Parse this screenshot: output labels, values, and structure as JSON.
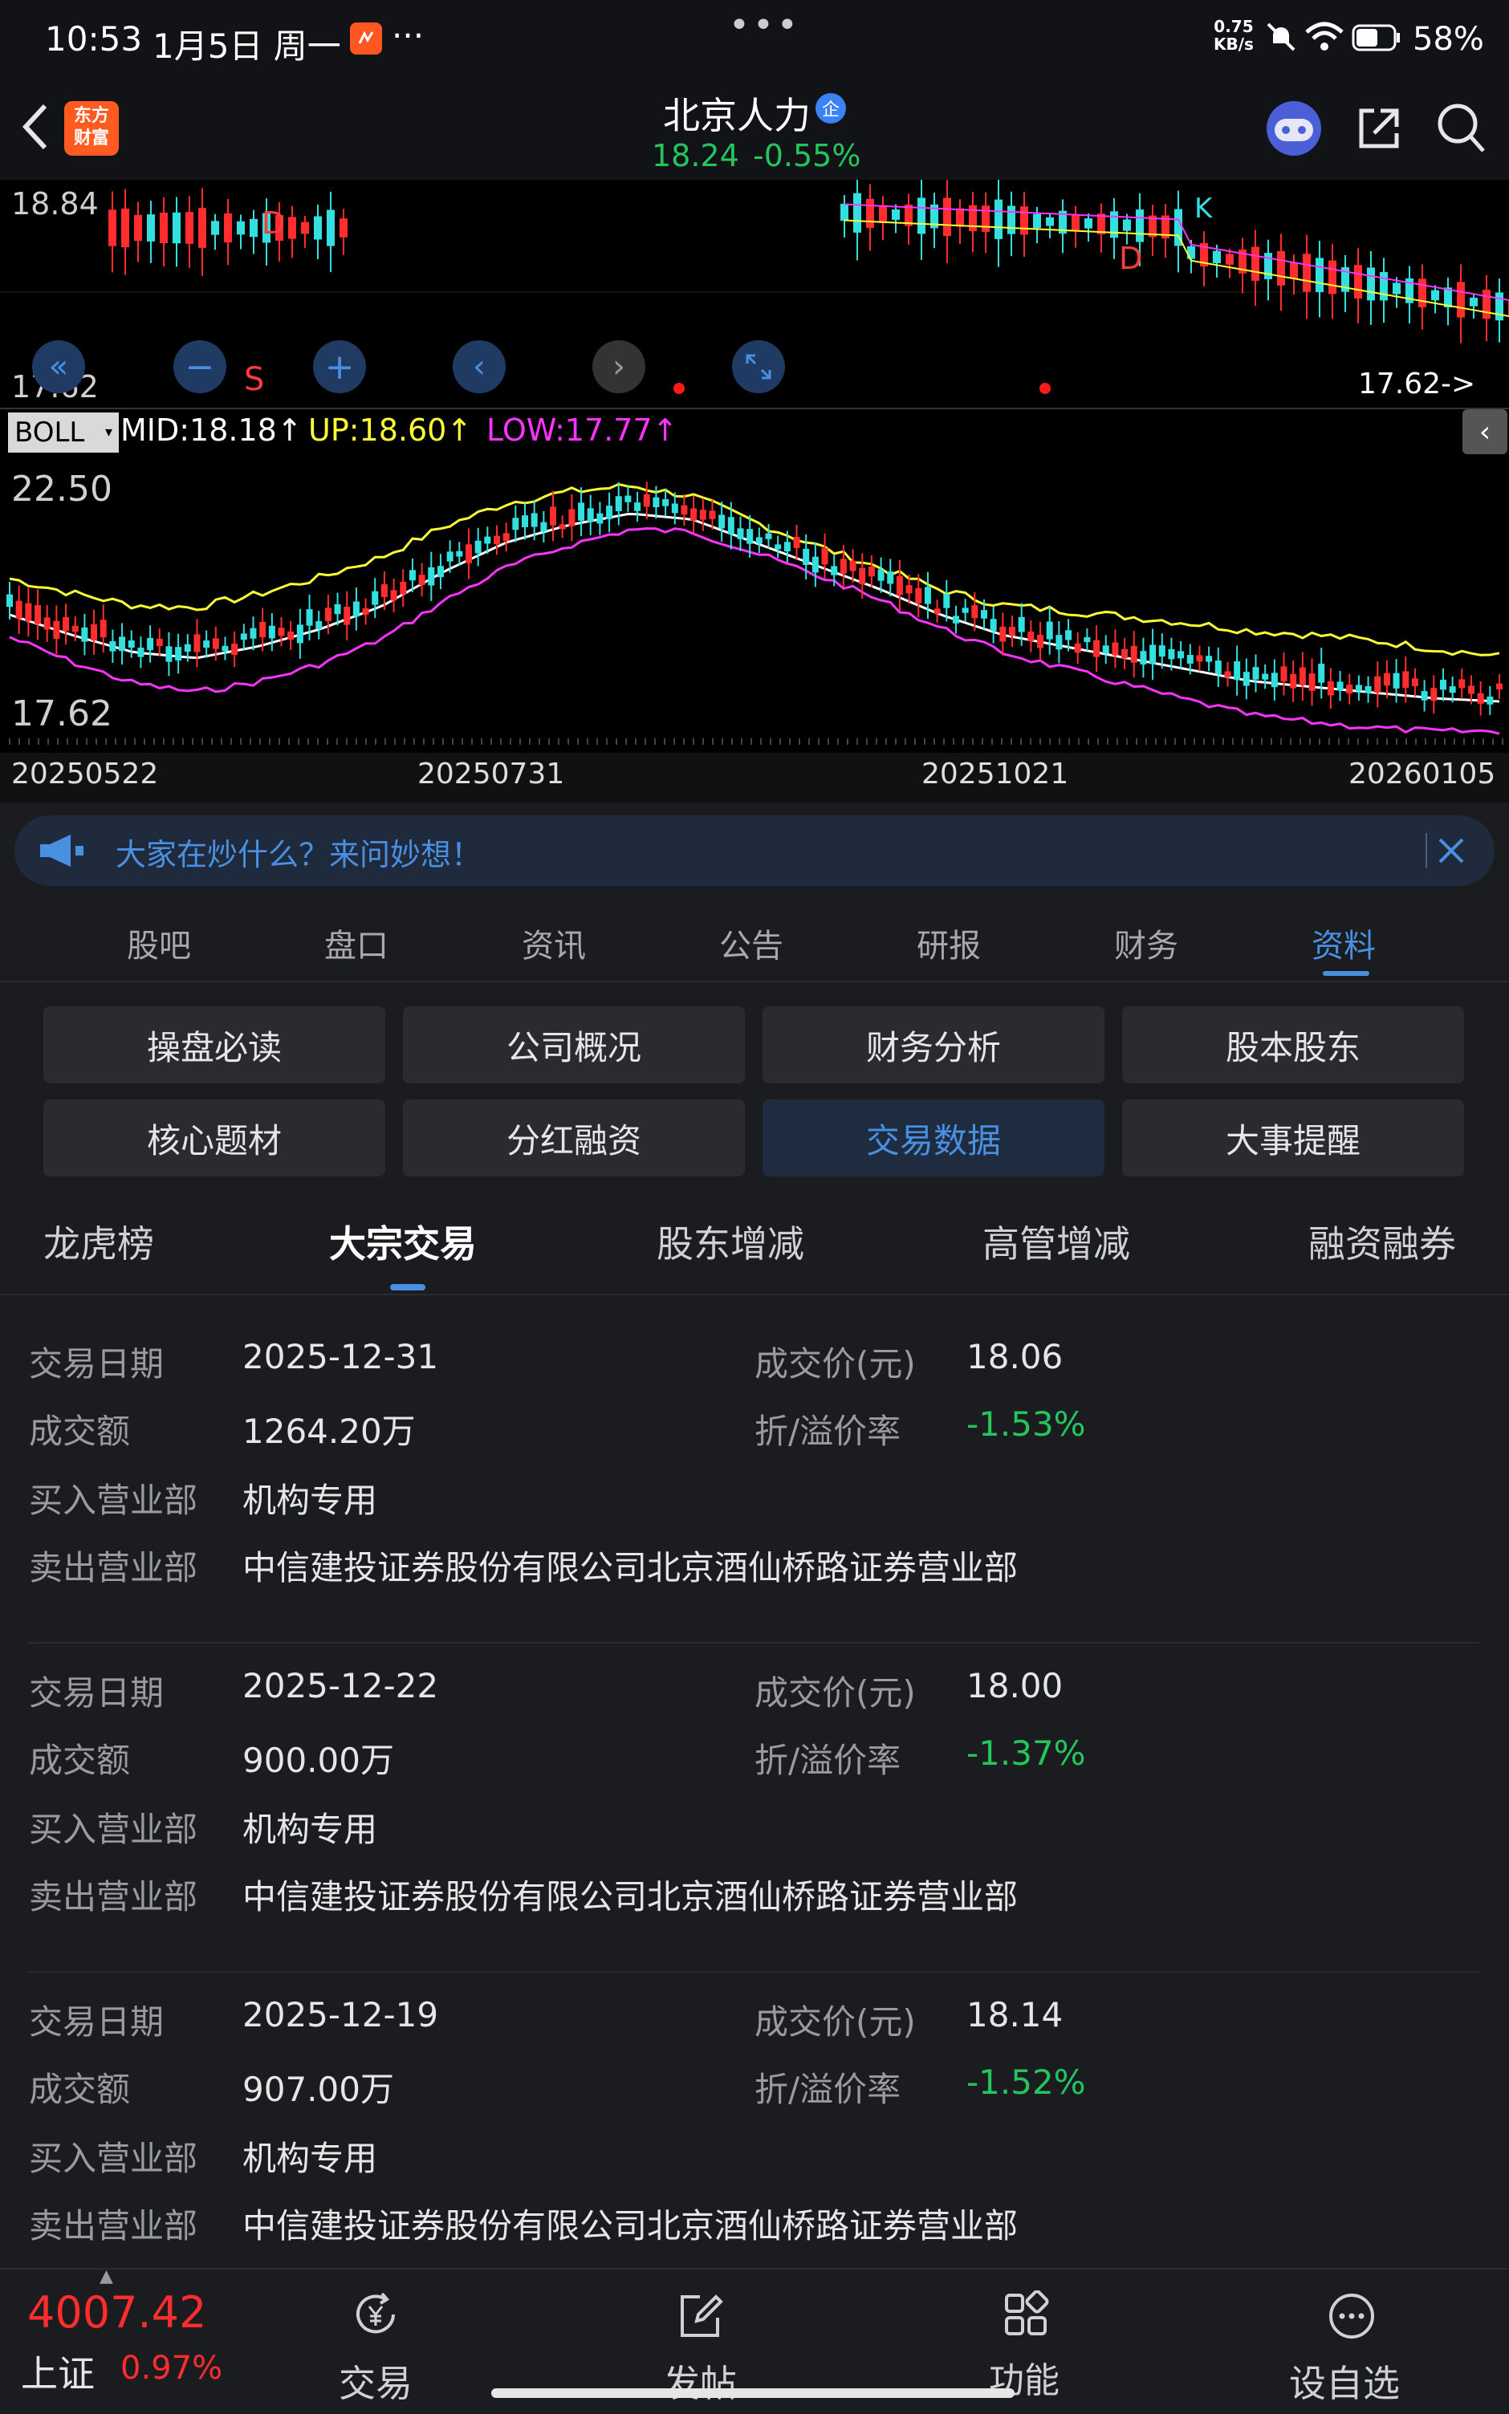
{
  "status": {
    "time": "10:53",
    "date": "1月5日 周一",
    "more": "···",
    "net_speed_value": "0.75",
    "net_speed_unit": "KB/s",
    "battery": "58%"
  },
  "nav": {
    "logo_line1": "东方",
    "logo_line2": "财富",
    "title": "北京人力",
    "price": "18.24",
    "change": "-0.55%"
  },
  "chart": {
    "top_price_high": "18.84",
    "top_price_low": "17.62",
    "marker_d1": "D",
    "marker_d2": "D",
    "marker_k": "K",
    "marker_s": "S",
    "last_low": "17.62->",
    "indicator": "BOLL",
    "mid": "MID:18.18↑",
    "up": "UP:18.60↑",
    "low": "LOW:17.77↑",
    "ov_high": "22.50",
    "ov_low": "17.62",
    "dates": [
      "20250522",
      "20250731",
      "20251021",
      "20260105"
    ]
  },
  "tip": {
    "text": "大家在炒什么？来问妙想！"
  },
  "tabs": [
    "股吧",
    "盘口",
    "资讯",
    "公告",
    "研报",
    "财务",
    "资料"
  ],
  "grid": [
    "操盘必读",
    "公司概况",
    "财务分析",
    "股本股东",
    "核心题材",
    "分红融资",
    "交易数据",
    "大事提醒"
  ],
  "subtabs": [
    "龙虎榜",
    "大宗交易",
    "股东增减",
    "高管增减",
    "融资融券"
  ],
  "labels": {
    "date": "交易日期",
    "amount": "成交额",
    "buyer": "买入营业部",
    "seller": "卖出营业部",
    "price": "成交价(元)",
    "premium": "折/溢价率"
  },
  "records": [
    {
      "date": "2025-12-31",
      "amount": "1264.20万",
      "buyer": "机构专用",
      "seller": "中信建投证券股份有限公司北京酒仙桥路证券营业部",
      "price": "18.06",
      "premium": "-1.53%"
    },
    {
      "date": "2025-12-22",
      "amount": "900.00万",
      "buyer": "机构专用",
      "seller": "中信建投证券股份有限公司北京酒仙桥路证券营业部",
      "price": "18.00",
      "premium": "-1.37%"
    },
    {
      "date": "2025-12-19",
      "amount": "907.00万",
      "buyer": "机构专用",
      "seller": "中信建投证券股份有限公司北京酒仙桥路证券营业部",
      "price": "18.14",
      "premium": "-1.52%"
    }
  ],
  "bottom": {
    "index_value": "4007.42",
    "index_name": "上证",
    "index_change": "0.97%",
    "trade": "交易",
    "post": "发帖",
    "func": "功能",
    "watchlist": "设自选"
  },
  "colors": {
    "accent": "#4a90e2",
    "up_red": "#ff2d2d",
    "down_green": "#22c55e",
    "boll_mid": "#ffffff",
    "boll_up": "#ffff33",
    "boll_low": "#ff33ff",
    "candle_down": "#33e0e0"
  }
}
